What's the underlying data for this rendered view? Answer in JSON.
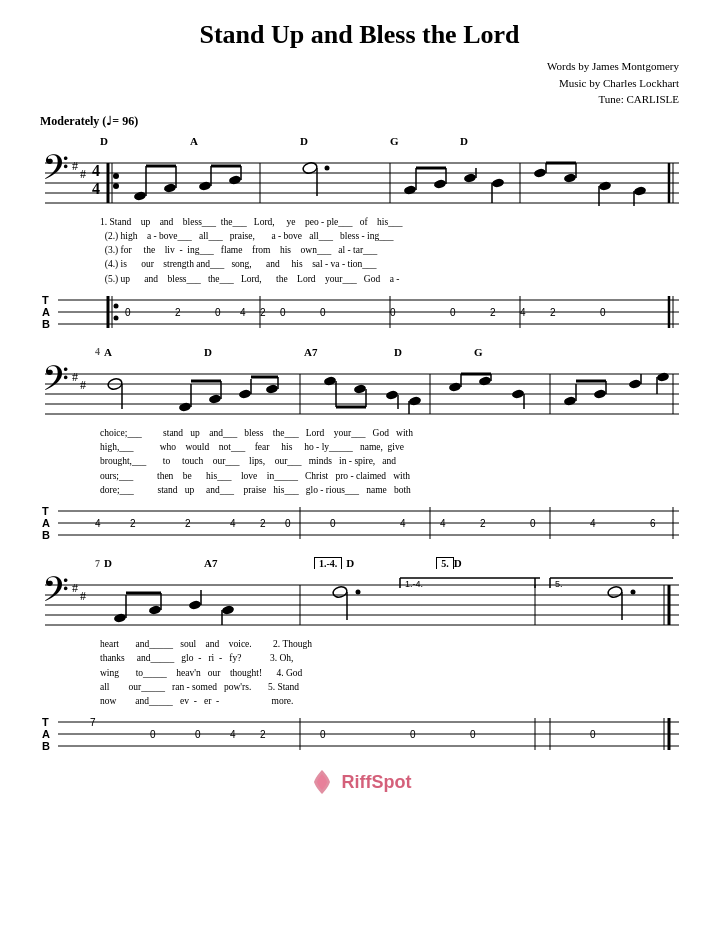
{
  "title": "Stand Up and Bless the Lord",
  "credits": {
    "words": "Words by James Montgomery",
    "music": "Music by Charles Lockhart",
    "tune": "Tune: CARLISLE"
  },
  "tempo": {
    "label": "Moderately",
    "bpm": "♩= 96"
  },
  "sections": [
    {
      "id": "section1",
      "measure_start": 1,
      "chords": [
        "D",
        "",
        "",
        "A",
        "",
        "",
        "D",
        "",
        "G",
        "",
        "D"
      ],
      "lyrics": [
        "1. Stand    up    and    bless___   the___   Lord,     ye    peo - ple___   of    his___",
        "  (2.) high    a - bove___   all___   praise,      a - bove   all___   bless - ing___",
        "  (3.) for     the    liv  -  ing___   flame    from    his    own___   al - tar___",
        "  (4.) is      our    strength and___   song,     and     his    sal - va - tion___",
        "  (5.) up      and    bless___   the___   Lord,     the    Lord    your___   God    a -"
      ],
      "tab": {
        "T": "",
        "A": "0   2         0   4  2  0         0       0   2  4  2  0",
        "B": ""
      }
    },
    {
      "id": "section2",
      "measure_start": 4,
      "chords": [
        "A",
        "",
        "D",
        "",
        "A7",
        "",
        "D",
        "",
        "G"
      ],
      "lyrics": [
        "choice;___        stand   up    and___   bless    the___   Lord    your___   God   with",
        "high,___          who    would    not___    fear    his     ho  -  ly_____   name,  give",
        "brought,___       to     touch    our___   lips,    our___   minds    in  -  spire,  and",
        "ours;___          then    be     his___    love    in_____   Christ   pro - claimed  with",
        "dore;___          stand   up    and___    praise   his___    glo - rious___   name   both"
      ],
      "tab": {
        "T": "",
        "A": "4  2       2     4  2  0        0    4  4  2            0    4          6",
        "B": ""
      }
    },
    {
      "id": "section3",
      "measure_start": 7,
      "chords": [
        "D",
        "",
        "A7",
        "",
        "D",
        "",
        "D"
      ],
      "volta": [
        "1.-4.",
        "5."
      ],
      "lyrics": [
        "heart      and_____   soul    and    voice.       2. Though",
        "thanks     and_____   glo  -  ri  -  fy?          3. Oh,",
        "wing       to_____    heav'n   our    thought!     4. God",
        "all        our_____   ran -  somed   pow'rs.       5. Stand",
        "now        and_____   ev  -   er  -               more."
      ],
      "tab": {
        "T": "7",
        "A": "     0       0       4  2       0           0     0          0",
        "B": ""
      }
    }
  ],
  "logo": {
    "symbol": "◈",
    "name": "RiffSpot"
  }
}
